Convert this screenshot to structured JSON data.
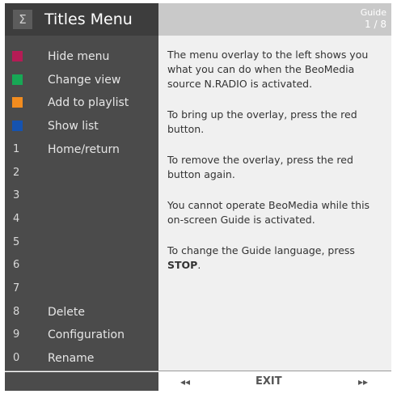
{
  "header": {
    "sigma_symbol": "Σ",
    "title": "Titles  Menu",
    "guide_label": "Guide",
    "guide_page": "1 / 8"
  },
  "menu": {
    "items": [
      {
        "key_type": "color",
        "color": "#b51c55",
        "label": "Hide menu"
      },
      {
        "key_type": "color",
        "color": "#17a855",
        "label": "Change view"
      },
      {
        "key_type": "color",
        "color": "#f28c1f",
        "label": "Add to playlist"
      },
      {
        "key_type": "color",
        "color": "#1553b0",
        "label": "Show list"
      },
      {
        "key_type": "number",
        "key": "1",
        "label": "Home/return"
      },
      {
        "key_type": "number",
        "key": "2",
        "label": ""
      },
      {
        "key_type": "number",
        "key": "3",
        "label": ""
      },
      {
        "key_type": "number",
        "key": "4",
        "label": ""
      },
      {
        "key_type": "number",
        "key": "5",
        "label": ""
      },
      {
        "key_type": "number",
        "key": "6",
        "label": ""
      },
      {
        "key_type": "number",
        "key": "7",
        "label": ""
      },
      {
        "key_type": "number",
        "key": "8",
        "label": "Delete"
      },
      {
        "key_type": "number",
        "key": "9",
        "label": "Configuration"
      },
      {
        "key_type": "number",
        "key": "0",
        "label": "Rename"
      }
    ]
  },
  "guide": {
    "p1": "The menu overlay to the left shows you what you can do when the BeoMedia source N.RADIO is activated.",
    "p2": "To bring up the overlay, press the red button.",
    "p3": "To remove the overlay, press the red button again.",
    "p4": "You cannot operate BeoMedia while this on-screen Guide is activated.",
    "p5_text": "To change the Guide language, press ",
    "p5_bold": "STOP",
    "p5_end": "."
  },
  "footer": {
    "prev_icon": "◂◂",
    "exit_label": "EXIT",
    "next_icon": "▸▸"
  }
}
